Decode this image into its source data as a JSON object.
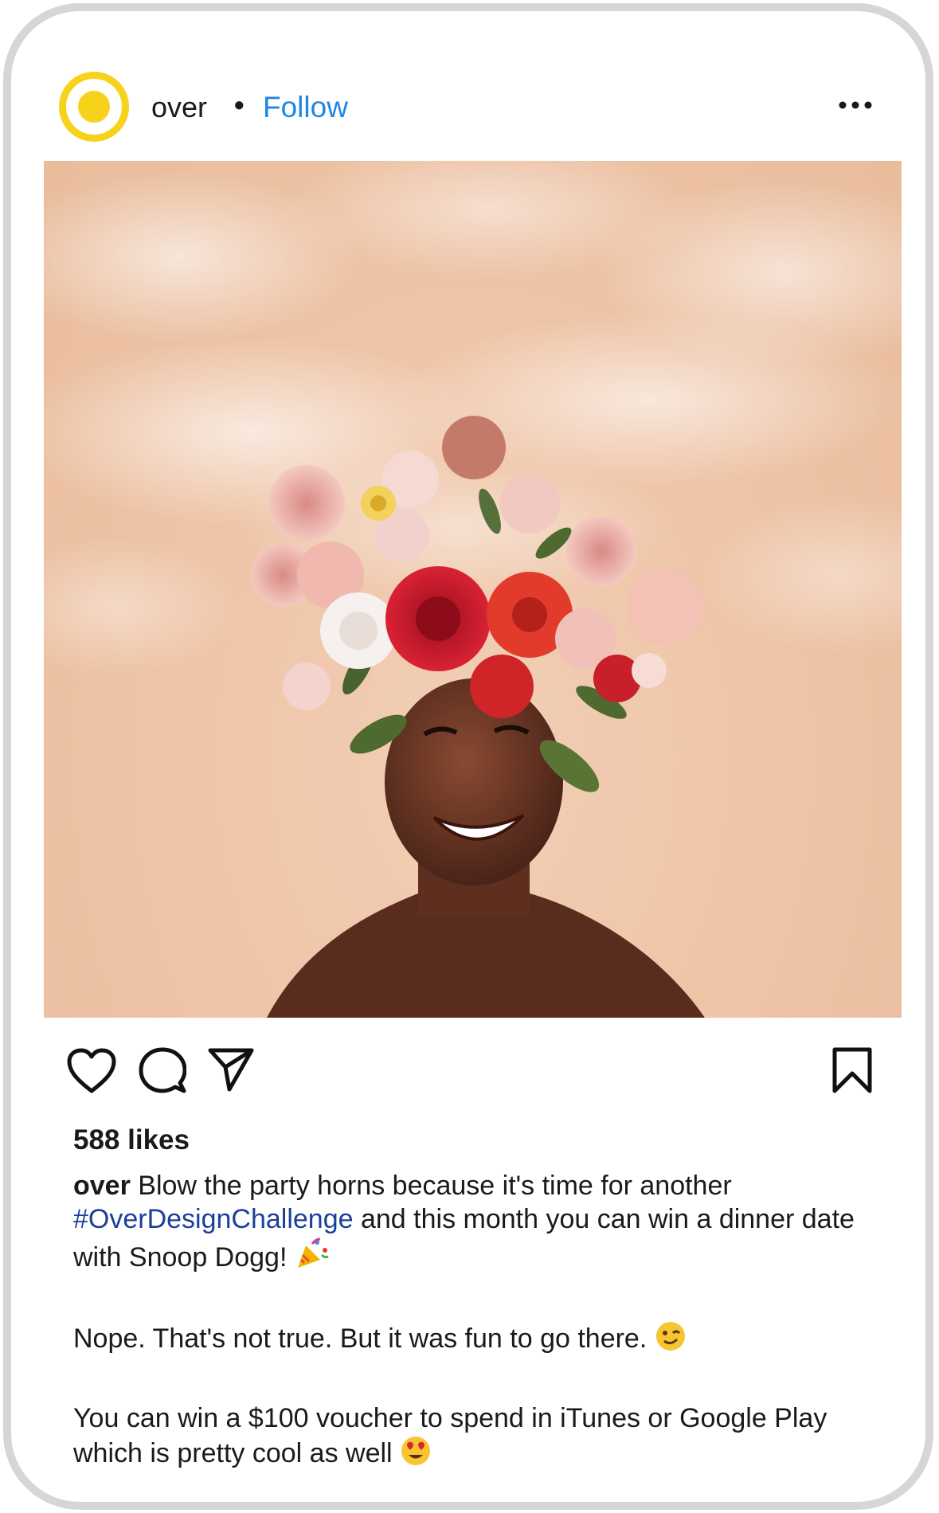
{
  "post": {
    "username": "over",
    "separator": "•",
    "follow_label": "Follow",
    "more_icon": "more-dots-icon",
    "likes": "588 likes",
    "caption": {
      "username": "over",
      "line1_text": " Blow the party horns because it's time for another ",
      "hashtag": "#OverDesignChallenge",
      "line1_rest": " and this month you can win a dinner date with Snoop Dogg! ",
      "para2": "Nope. That's not true. But it was fun to go there. ",
      "para3": "You can win a $100 voucher to spend in iTunes or Google Play which is pretty cool as well "
    }
  },
  "icons": {
    "like": "heart-icon",
    "comment": "comment-icon",
    "share": "send-icon",
    "save": "bookmark-icon",
    "emoji1": "party-popper-emoji",
    "emoji2": "winking-face-emoji",
    "emoji3": "heart-eyes-emoji"
  },
  "colors": {
    "brand_yellow": "#f7d21a",
    "follow_blue": "#1f86e8",
    "hashtag_blue": "#1c3f9a",
    "photo_background": "#efc5a8"
  }
}
